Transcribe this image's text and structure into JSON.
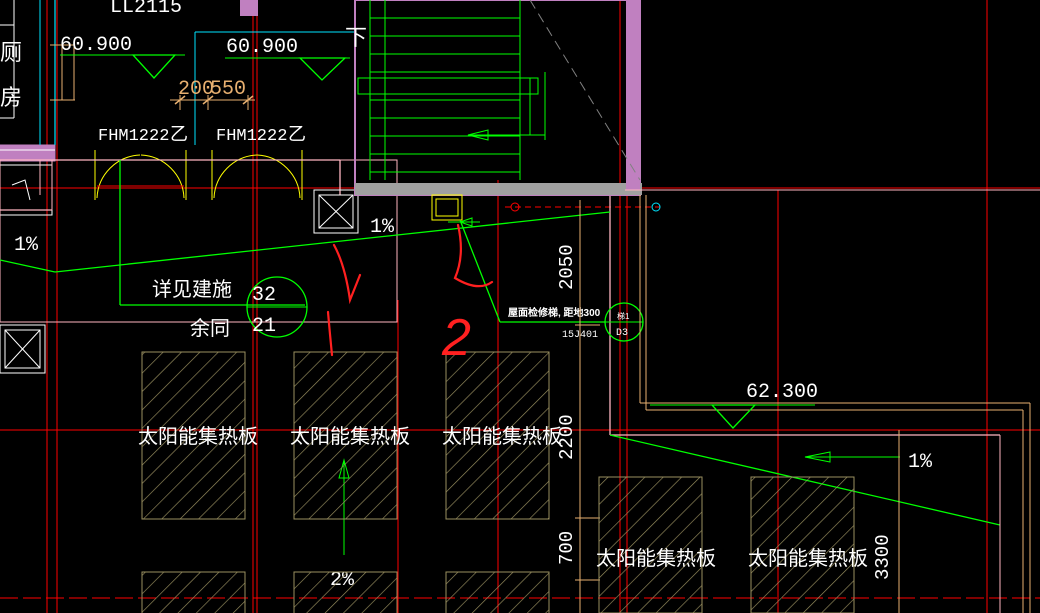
{
  "labels": {
    "elev_top_left": "60.900",
    "elev_top_mid": "60.900",
    "elev_right": "62.300",
    "partial_top": "LL2115",
    "stair_down": "下",
    "dim_200": "200",
    "dim_550": "550",
    "door_1": "FHM1222",
    "door_1_grade": "乙",
    "door_2": "FHM1222",
    "door_2_grade": "乙",
    "slope_top_left": "1%",
    "slope_mid": "1%",
    "slope_right": "1%",
    "slope_bottom": "2%",
    "see_arch": "详见建施",
    "same_rest": "余同",
    "ref_top": "32",
    "ref_bottom": "21",
    "ladder_note": "屋面检修梯, 距地300",
    "ladder_std": "15J401",
    "detail_top": "梯1",
    "detail_bottom": "D3",
    "dim_2050": "2050",
    "dim_2200": "2200",
    "dim_700": "700",
    "dim_3300": "3300",
    "solar_panel": "太阳能集热板",
    "handwritten_1": "1",
    "handwritten_2": "2"
  },
  "colors": {
    "background": "#000000",
    "axis_red": "#ff0000",
    "green": "#00ff00",
    "white": "#ffffff",
    "pink": "#ffb6c1",
    "magenta_wall": "#c080c0",
    "cyan": "#00e5ff",
    "yellow": "#ffff00",
    "tan": "#e8b070",
    "hatch": "#9a9060",
    "markup_red": "#ff2020"
  },
  "icons": [
    "elevation-marker-icon",
    "roof-hatch-icon",
    "slope-arrow-icon",
    "detail-callout-icon",
    "door-swing-icon",
    "dimension-tick-icon",
    "axis-circle-icon"
  ]
}
